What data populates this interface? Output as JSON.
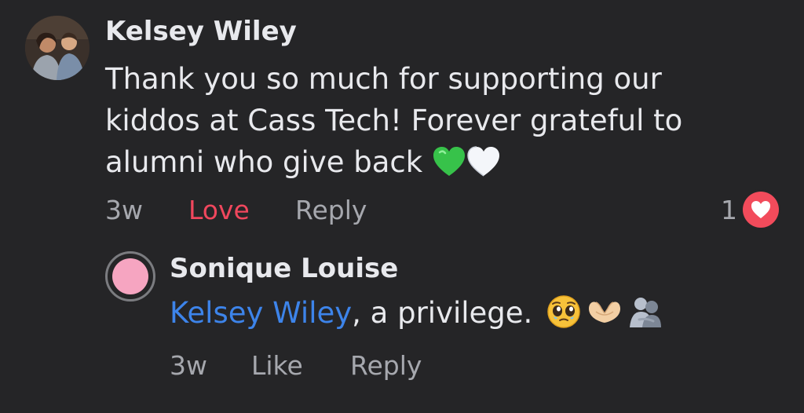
{
  "comment": {
    "author": "Kelsey Wiley",
    "text": "Thank you so much for supporting our kiddos at Cass Tech! Forever grateful to alumni who give back",
    "emojis": [
      "green-heart-icon",
      "white-heart-icon"
    ],
    "time": "3w",
    "love_label": "Love",
    "reply_label": "Reply",
    "reaction_count": "1",
    "reaction_type": "love-reaction-icon"
  },
  "reply": {
    "author": "Sonique Louise",
    "mention": "Kelsey Wiley",
    "text": ", a privilege.",
    "emojis": [
      "pleading-face-icon",
      "heart-hands-icon",
      "people-hugging-icon"
    ],
    "time": "3w",
    "like_label": "Like",
    "reply_label": "Reply"
  },
  "colors": {
    "background": "#252527",
    "love_active": "#f0475d",
    "mention": "#3d84ea",
    "avatar_pink": "#f6a5c1"
  }
}
